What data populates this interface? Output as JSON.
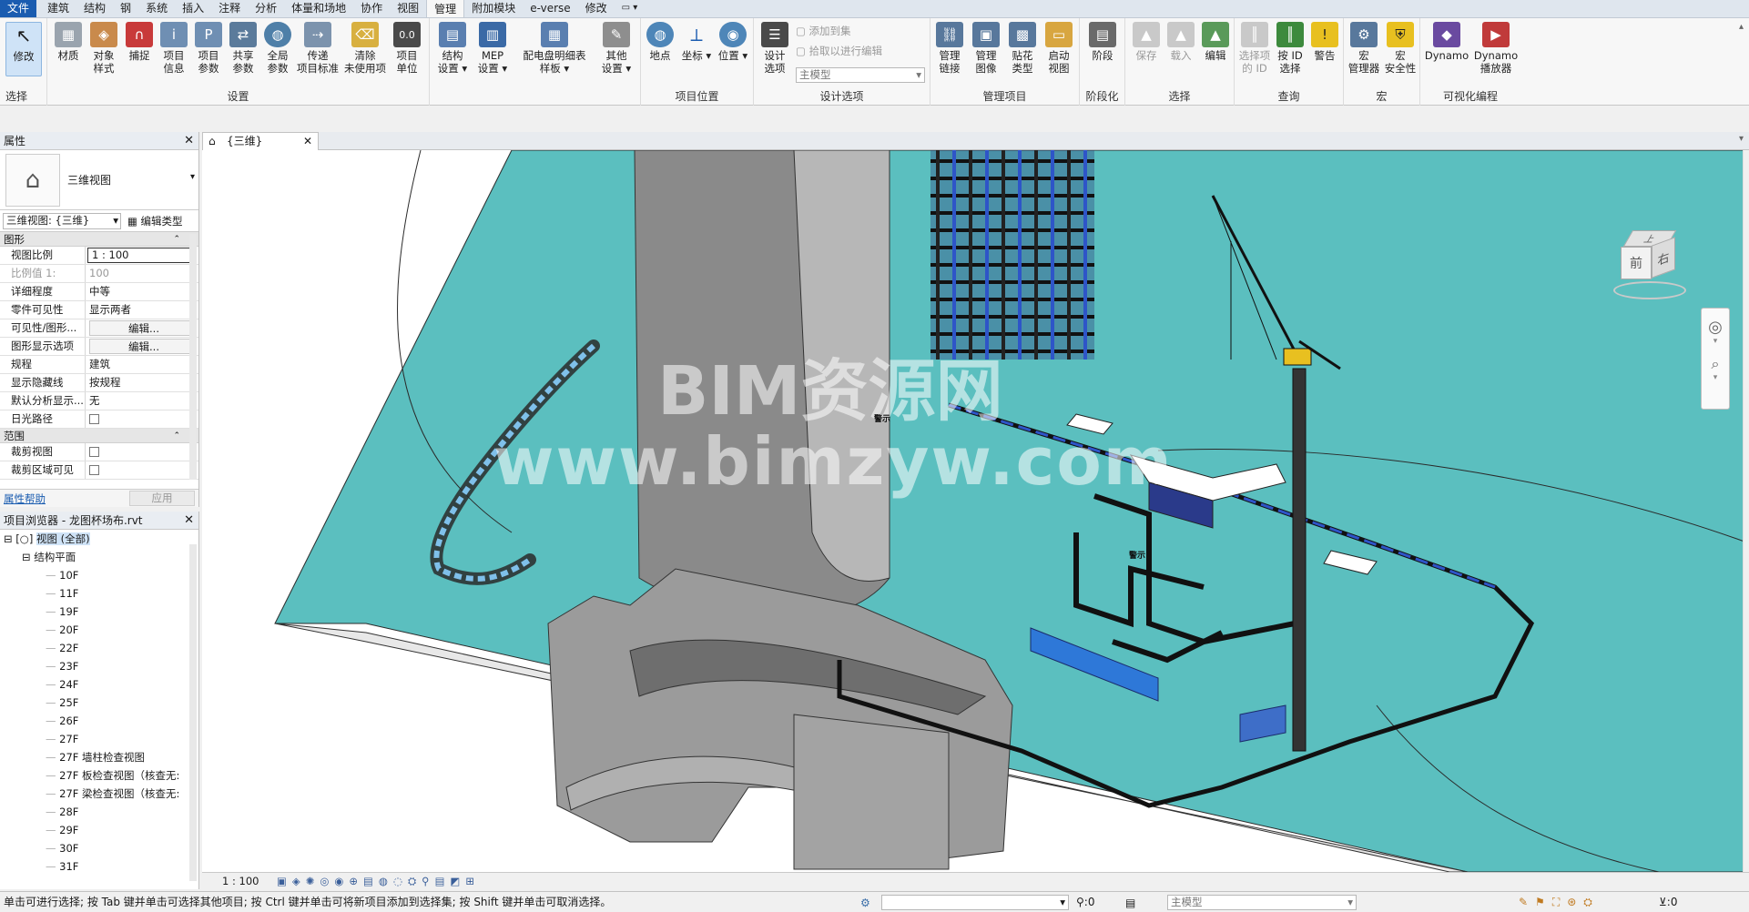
{
  "tabs": [
    "文件",
    "建筑",
    "结构",
    "钢",
    "系统",
    "插入",
    "注释",
    "分析",
    "体量和场地",
    "协作",
    "视图",
    "管理",
    "附加模块",
    "e-verse",
    "修改"
  ],
  "active_tab": "管理",
  "ribbon": {
    "modify": {
      "label": "修改",
      "panel": "选择"
    },
    "settings_buttons": [
      "材质",
      "对象\n样式",
      "捕捉",
      "项目\n信息",
      "项目\n参数",
      "共享\n参数",
      "全局\n参数",
      "传递\n项目标准",
      "清除\n未使用项",
      "项目\n单位"
    ],
    "settings_panel": "设置",
    "mep_buttons": [
      "结构\n设置",
      "MEP\n设置",
      "配电盘明细表\n样板",
      "其他\n设置"
    ],
    "location_buttons": [
      "地点",
      "坐标",
      "位置"
    ],
    "location_panel": "项目位置",
    "design_options": {
      "button": "设计\n选项",
      "add": "添加到集",
      "pick": "拾取以进行编辑",
      "main_model": "主模型",
      "panel": "设计选项"
    },
    "manage_project_buttons": [
      "管理\n链接",
      "管理\n图像",
      "贴花\n类型",
      "启动\n视图"
    ],
    "manage_project_panel": "管理项目",
    "phasing": {
      "button": "阶段",
      "panel": "阶段化"
    },
    "selection_buttons": [
      "保存",
      "载入",
      "编辑"
    ],
    "selection_panel": "选择",
    "inquiry_buttons": [
      "选择项\n的 ID",
      "按 ID\n选择",
      "警告"
    ],
    "inquiry_panel": "查询",
    "macro_buttons": [
      "宏\n管理器",
      "宏\n安全性"
    ],
    "macro_panel": "宏",
    "dynamo_buttons": [
      "Dynamo",
      "Dynamo\n播放器"
    ],
    "dynamo_panel": "可视化编程"
  },
  "properties": {
    "title": "属性",
    "type_name": "三维视图",
    "selector": "三维视图: {三维}",
    "edit_type": "编辑类型",
    "group_graphics": "图形",
    "rows": [
      {
        "k": "视图比例",
        "v": "1 : 100"
      },
      {
        "k": "比例值 1:",
        "v": "100"
      },
      {
        "k": "详细程度",
        "v": "中等"
      },
      {
        "k": "零件可见性",
        "v": "显示两者"
      },
      {
        "k": "可见性/图形...",
        "v": "编辑..."
      },
      {
        "k": "图形显示选项",
        "v": "编辑..."
      },
      {
        "k": "规程",
        "v": "建筑"
      },
      {
        "k": "显示隐藏线",
        "v": "按规程"
      },
      {
        "k": "默认分析显示...",
        "v": "无"
      },
      {
        "k": "日光路径",
        "v": ""
      }
    ],
    "group_extents": "范围",
    "rows2": [
      {
        "k": "裁剪视图",
        "v": ""
      },
      {
        "k": "裁剪区域可见",
        "v": ""
      }
    ],
    "help": "属性帮助",
    "apply": "应用"
  },
  "browser": {
    "title": "项目浏览器 - 龙图杯场布.rvt",
    "root": "视图 (全部)",
    "group": "结构平面",
    "items": [
      "10F",
      "11F",
      "19F",
      "20F",
      "22F",
      "23F",
      "24F",
      "25F",
      "26F",
      "27F",
      "27F 墙柱检查视图",
      "27F 板检查视图（核查无:",
      "27F 梁检查视图（核查无:",
      "28F",
      "29F",
      "30F",
      "31F"
    ]
  },
  "view_tab": "{三维}",
  "viewcube": {
    "top": "上",
    "front": "前",
    "right": "右"
  },
  "watermark": {
    "line1": "BIM资源网",
    "line2": "www.bimzyw.com"
  },
  "signs": [
    "警示",
    "警示"
  ],
  "viewbar_scale": "1 : 100",
  "status": {
    "hint": "单击可进行选择; 按 Tab 键并单击可选择其他项目; 按 Ctrl 键并单击可将新项目添加到选择集; 按 Shift 键并单击可取消选择。",
    "count": ":0",
    "main_model": "主模型",
    "filter": ":0"
  },
  "colors": {
    "ground": "#5bbfbf",
    "building": "#8a8a8a",
    "steel": "#1f3a9e",
    "accent": "#1a5cb0"
  }
}
